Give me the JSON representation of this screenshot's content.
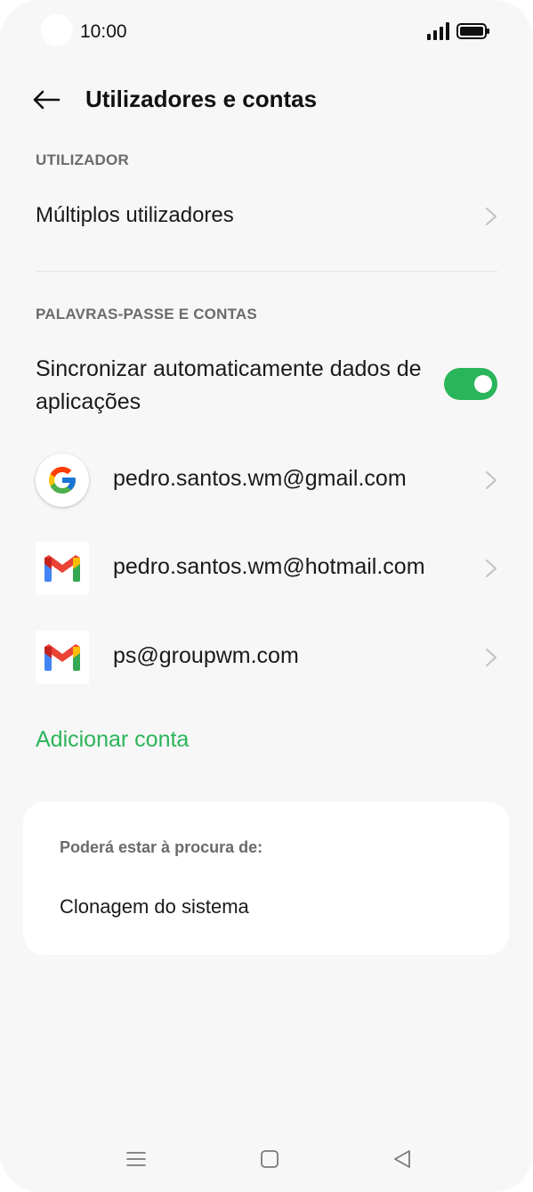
{
  "status_bar": {
    "time": "10:00"
  },
  "header": {
    "title": "Utilizadores e contas"
  },
  "sections": {
    "user": {
      "label": "UTILIZADOR",
      "items": [
        {
          "label": "Múltiplos utilizadores",
          "icon": "chevron-right-icon"
        }
      ]
    },
    "accounts": {
      "label": "PALAVRAS-PASSE E CONTAS",
      "sync": {
        "label": "Sincronizar automaticamente dados de aplicações",
        "enabled": true
      },
      "list": [
        {
          "email": "pedro.santos.wm@gmail.com",
          "icon": "google-icon"
        },
        {
          "email": "pedro.santos.wm@hotmail.com",
          "icon": "gmail-icon"
        },
        {
          "email": "ps@groupwm.com",
          "icon": "gmail-icon"
        }
      ],
      "add_label": "Adicionar conta"
    }
  },
  "suggestions": {
    "title": "Poderá estar à procura de:",
    "items": [
      "Clonagem do sistema"
    ]
  },
  "colors": {
    "accent": "#2bb55a",
    "background": "#f7f7f7",
    "card": "#ffffff"
  }
}
